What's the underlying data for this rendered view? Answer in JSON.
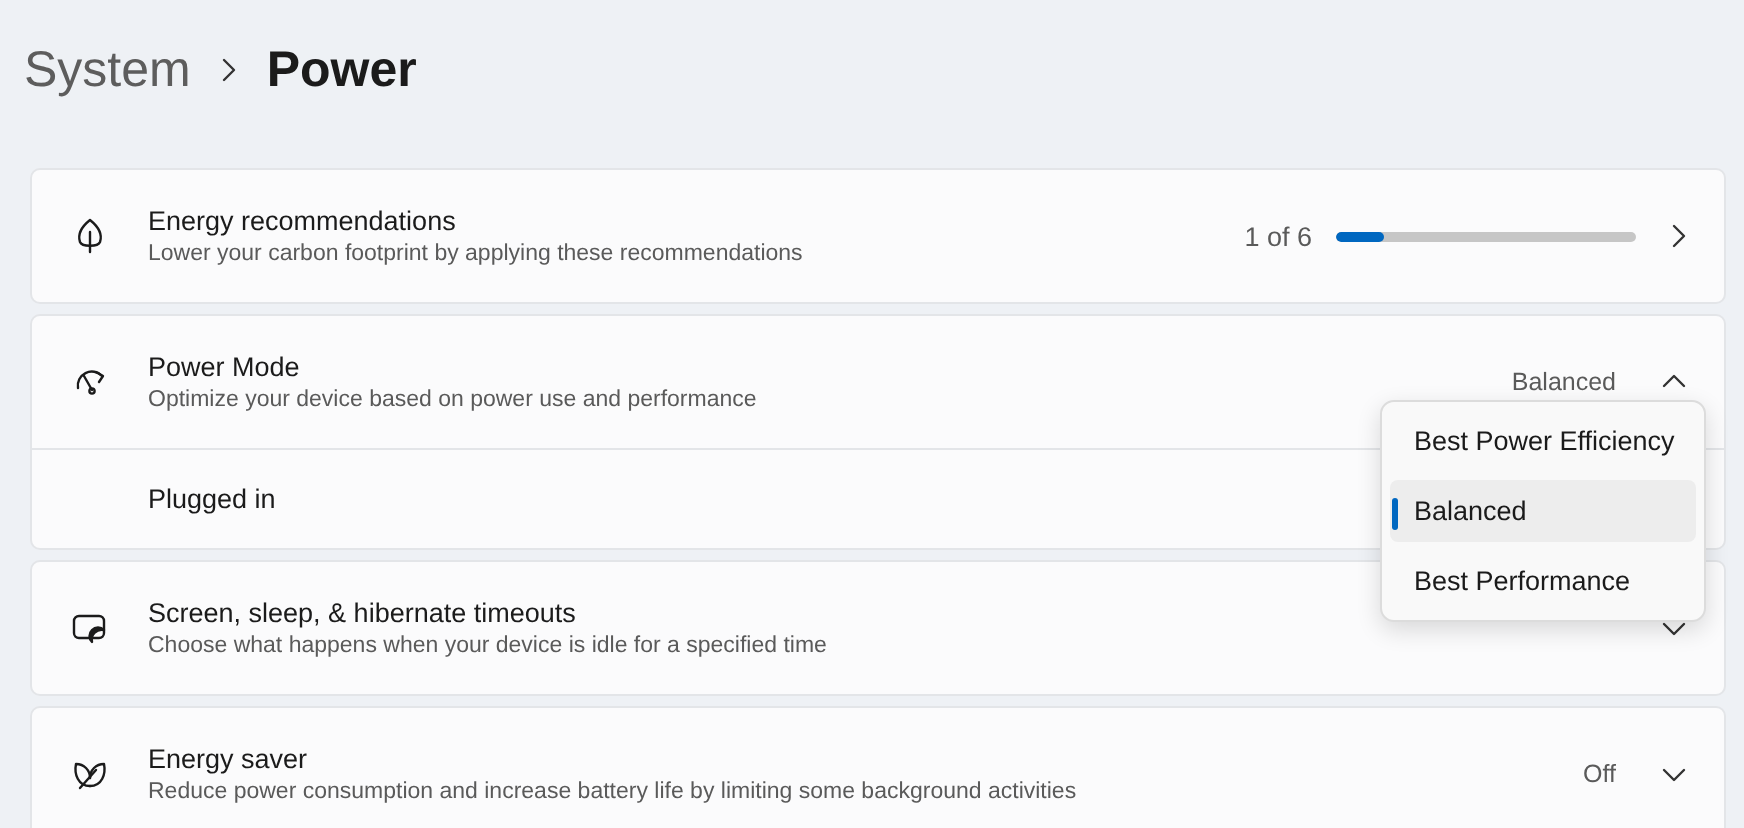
{
  "breadcrumb": {
    "parent": "System",
    "current": "Power"
  },
  "cards": [
    {
      "kind": "link",
      "title": "Energy recommendations",
      "description": "Lower your carbon footprint by applying these recommendations",
      "counter": "1 of 6",
      "level": 0.16
    },
    {
      "kind": "expander",
      "expanded": true,
      "title": "Power Mode",
      "description": "Optimize your device based on power use and performance",
      "value": "Balanced",
      "rows": [
        {
          "label": "Plugged in"
        }
      ]
    },
    {
      "kind": "expander",
      "expanded": false,
      "title": "Screen, sleep, & hibernate timeouts",
      "description": "Choose what happens when your device is idle for a specified time"
    },
    {
      "kind": "expander",
      "expanded": false,
      "title": "Energy saver",
      "description": "Reduce power consumption and increase battery life by limiting some background activities",
      "value": "Off"
    }
  ],
  "dropdown": {
    "options": [
      {
        "label": "Best Power Efficiency",
        "selected": false
      },
      {
        "label": "Balanced",
        "selected": true
      },
      {
        "label": "Best Performance",
        "selected": false
      }
    ]
  }
}
